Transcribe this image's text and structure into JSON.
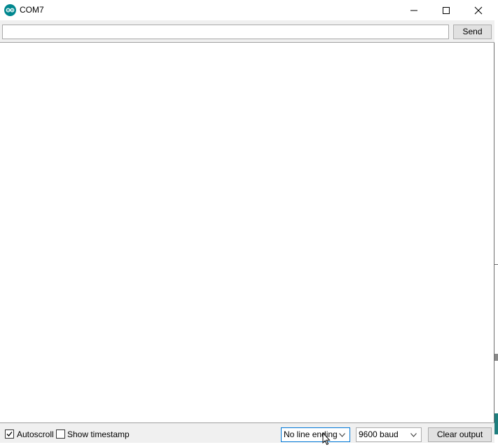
{
  "window": {
    "title": "COM7",
    "app_icon": "arduino-logo-icon"
  },
  "toolbar": {
    "input_value": "",
    "send_label": "Send"
  },
  "output": {
    "text": ""
  },
  "statusbar": {
    "autoscroll_label": "Autoscroll",
    "autoscroll_checked": true,
    "timestamp_label": "Show timestamp",
    "timestamp_checked": false,
    "line_ending_selected": "No line ending",
    "baud_selected": "9600 baud",
    "clear_label": "Clear output"
  },
  "colors": {
    "accent": "#00878f",
    "focus_border": "#0078d7",
    "panel_bg": "#f0f0f0"
  }
}
